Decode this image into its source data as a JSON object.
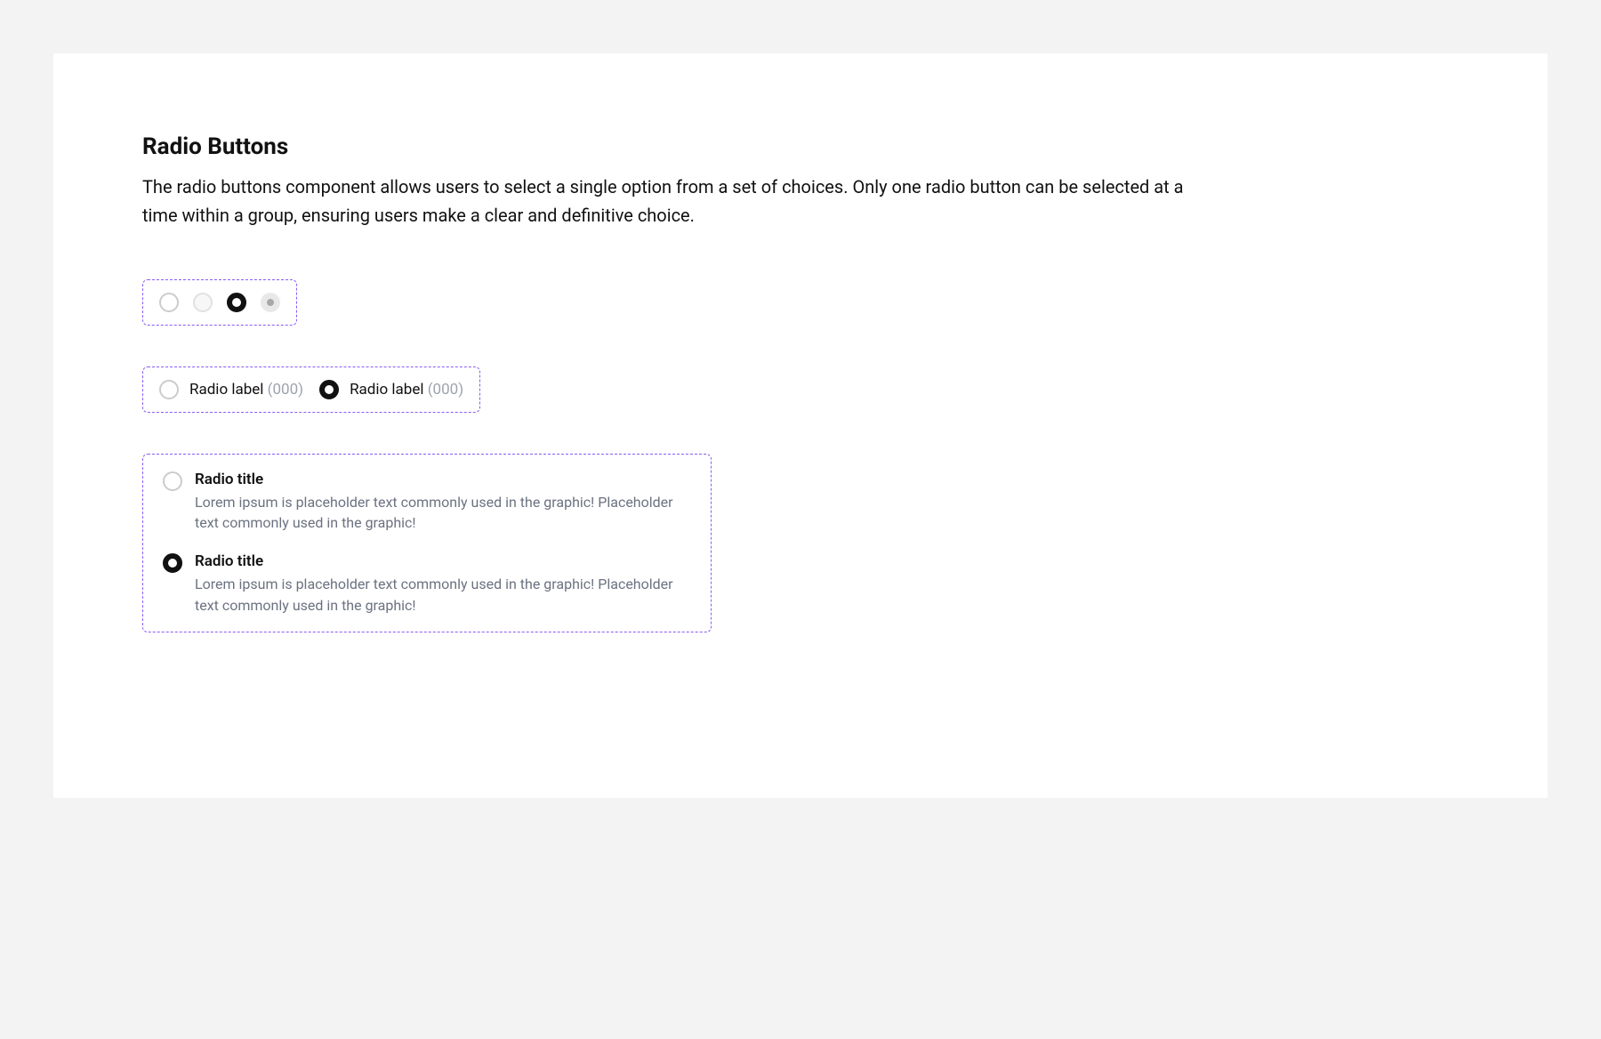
{
  "heading": "Radio Buttons",
  "description": "The radio buttons component allows users to select a single option from a set of choices. Only one radio button can be selected at a time within a group, ensuring users make a clear and definitive choice.",
  "labeled": {
    "item1": {
      "label": "Radio label",
      "count": "(000)"
    },
    "item2": {
      "label": "Radio label",
      "count": "(000)"
    }
  },
  "titled": {
    "item1": {
      "title": "Radio title",
      "desc": "Lorem ipsum is placeholder text commonly used in the graphic! Placeholder text commonly used in the graphic!"
    },
    "item2": {
      "title": "Radio title",
      "desc": "Lorem ipsum is placeholder text commonly used in the graphic! Placeholder text commonly used in the graphic!"
    }
  }
}
